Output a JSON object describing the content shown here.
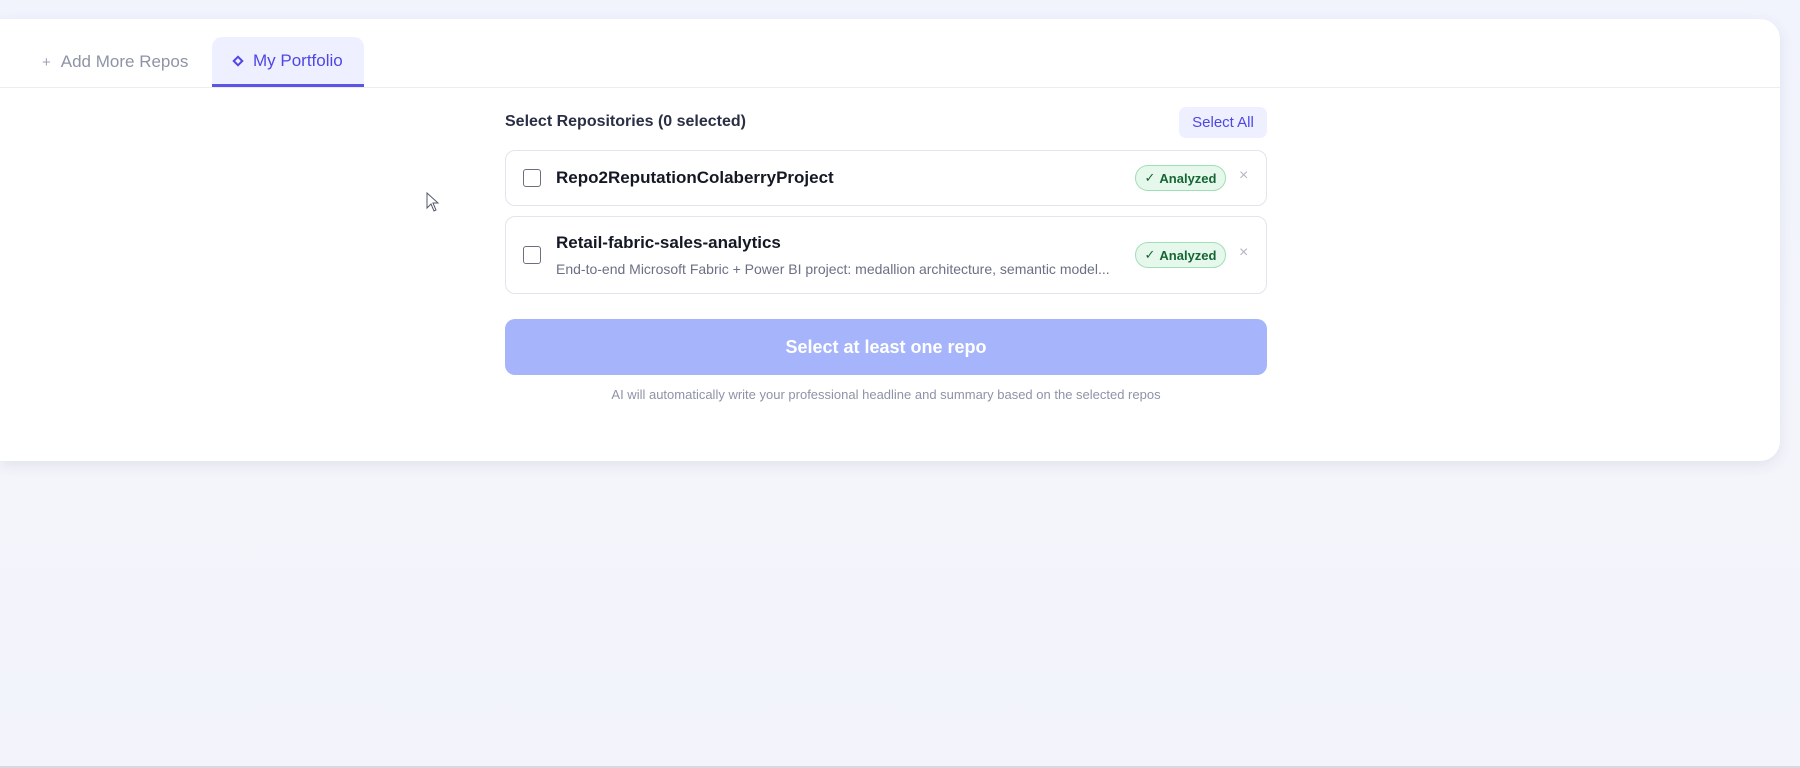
{
  "tabs": [
    {
      "icon": "plus-icon",
      "glyph": "+",
      "label": "Add More Repos",
      "active": false
    },
    {
      "icon": "diamond-icon",
      "label": "My Portfolio",
      "active": true
    }
  ],
  "main": {
    "section_title": "Select Repositories (0 selected)",
    "select_all_label": "Select All",
    "repos": [
      {
        "name": "Repo2ReputationColaberryProject",
        "description": "",
        "checked": false,
        "badge_check": "✓",
        "badge_label": "Analyzed",
        "remove_glyph": "×"
      },
      {
        "name": "Retail-fabric-sales-analytics",
        "description": "End-to-end Microsoft Fabric + Power BI project: medallion architecture, semantic model...",
        "checked": false,
        "badge_check": "✓",
        "badge_label": "Analyzed",
        "remove_glyph": "×"
      }
    ],
    "submit_label": "Select at least one repo",
    "submit_disabled": true,
    "hint": "AI will automatically write your professional headline and summary based on the selected repos"
  },
  "colors": {
    "accent": "#4f46e5",
    "badge_green": "#166534",
    "disabled_button": "#a5b4fb"
  }
}
